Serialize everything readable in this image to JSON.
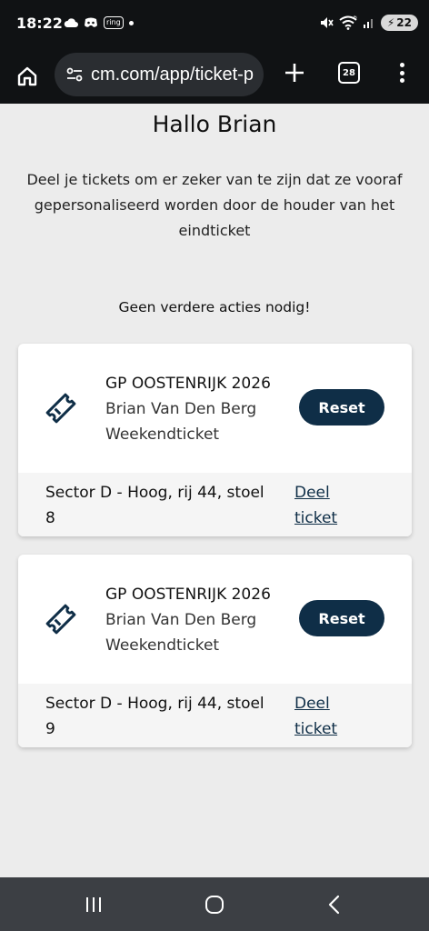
{
  "status_bar": {
    "time": "18:22",
    "ring_label": "ring",
    "wifi_badge": "6",
    "battery": "22",
    "icons": [
      "cloud-icon",
      "discord-icon",
      "ring-icon",
      "mute-icon",
      "wifi-icon",
      "signal-icon",
      "battery-icon"
    ]
  },
  "browser": {
    "url": "cm.com/app/ticket-p",
    "tab_count": "28",
    "icons": [
      "home-icon",
      "site-settings-icon",
      "plus-icon",
      "tabs-icon",
      "more-icon"
    ]
  },
  "page": {
    "title": "Hallo Brian",
    "intro": "Deel je tickets om er zeker van te zijn dat ze vooraf gepersonaliseerd worden door de houder van het eindticket",
    "status_message": "Geen verdere acties nodig!"
  },
  "tickets": [
    {
      "event": "GP OOSTENRIJK 2026",
      "holder": "Brian Van Den Berg",
      "type": "Weekendticket",
      "reset_label": "Reset",
      "seat": "Sector D - Hoog, rij 44, stoel 8",
      "share_label": "Deel ticket"
    },
    {
      "event": "GP OOSTENRIJK 2026",
      "holder": "Brian Van Den Berg",
      "type": "Weekendticket",
      "reset_label": "Reset",
      "seat": "Sector D - Hoog, rij 44, stoel 9",
      "share_label": "Deel ticket"
    }
  ],
  "colors": {
    "accent": "#0f2e47",
    "page_background": "#ececec",
    "browser_chrome": "#101214",
    "nav_bar": "#3c3f44"
  }
}
